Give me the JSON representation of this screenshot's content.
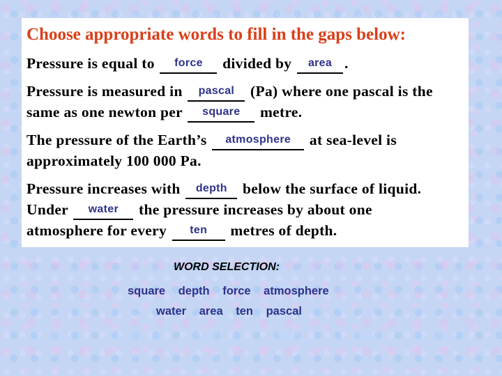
{
  "title": "Choose appropriate words to fill in the gaps below:",
  "paragraphs": {
    "p1": {
      "t1": "Pressure is equal to ",
      "a1": "force",
      "t2": " divided by ",
      "a2": "area",
      "t3": "."
    },
    "p2": {
      "t1": "Pressure is measured in ",
      "a1": "pascal",
      "t2": " (Pa) where one pascal is the",
      "t3": "same as one newton per ",
      "a2": "square",
      "t4": " metre."
    },
    "p3": {
      "t1": "The pressure of the Earth’s ",
      "a1": "atmosphere",
      "t2": " at sea-level is",
      "t3": "approximately 100 000 Pa."
    },
    "p4": {
      "t1": "Pressure increases with ",
      "a1": "depth",
      "t2": " below the surface of  liquid.",
      "t3": "Under ",
      "a2": "water",
      "t4": " the pressure increases by about one",
      "t5": "atmosphere for every ",
      "a3": "ten",
      "t6": " metres of depth."
    }
  },
  "word_selection": {
    "title": "WORD SELECTION:",
    "row1": [
      "square",
      "depth",
      "force",
      "atmosphere"
    ],
    "row2": [
      "water",
      "area",
      "ten",
      "pascal"
    ]
  },
  "colors": {
    "title": "#d9401a",
    "answer": "#2e3289",
    "background": "#c4d6f4"
  }
}
